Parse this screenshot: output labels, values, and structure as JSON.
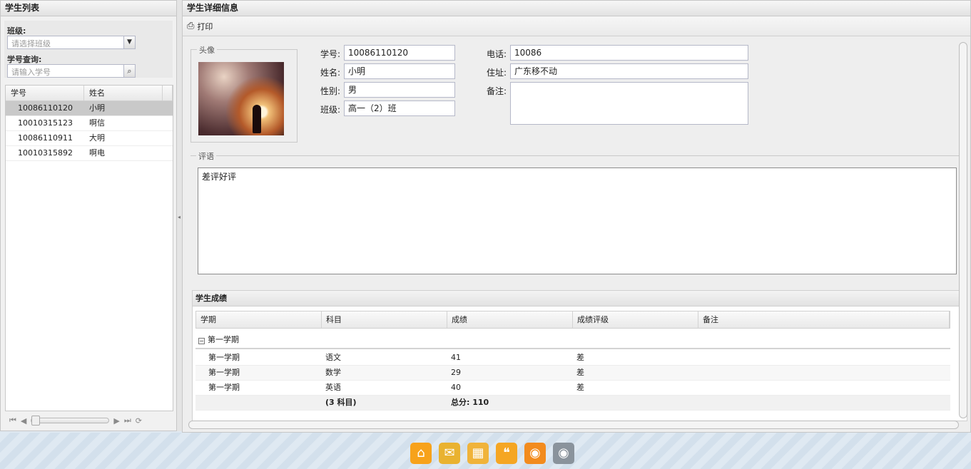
{
  "left_panel": {
    "title": "学生列表",
    "class_label": "班级:",
    "class_placeholder": "请选择班级",
    "query_label": "学号查询:",
    "query_placeholder": "请输入学号",
    "columns": [
      "学号",
      "姓名"
    ],
    "rows": [
      {
        "id": "10086110120",
        "name": "小明"
      },
      {
        "id": "10010315123",
        "name": "啊信"
      },
      {
        "id": "10086110911",
        "name": "大明"
      },
      {
        "id": "10010315892",
        "name": "啊电"
      }
    ]
  },
  "right_panel": {
    "title": "学生详细信息",
    "print_label": "打印",
    "photo_legend": "头像",
    "fields": {
      "id_label": "学号:",
      "id_value": "10086110120",
      "name_label": "姓名:",
      "name_value": "小明",
      "gender_label": "性别:",
      "gender_value": "男",
      "class_label": "班级:",
      "class_value": "高一（2）班",
      "phone_label": "电话:",
      "phone_value": "10086",
      "address_label": "住址:",
      "address_value": "广东移不动",
      "note_label": "备注:",
      "note_value": ""
    },
    "comment_legend": "评语",
    "comment_value": "差评好评",
    "scores": {
      "title": "学生成绩",
      "columns": [
        "学期",
        "科目",
        "成绩",
        "成绩评级",
        "备注"
      ],
      "group": "第一学期",
      "rows": [
        {
          "term": "第一学期",
          "subject": "语文",
          "score": "41",
          "grade": "差",
          "note": ""
        },
        {
          "term": "第一学期",
          "subject": "数学",
          "score": "29",
          "grade": "差",
          "note": ""
        },
        {
          "term": "第一学期",
          "subject": "英语",
          "score": "40",
          "grade": "差",
          "note": ""
        }
      ],
      "summary": {
        "subject": "(3 科目)",
        "score": "总分: 110"
      }
    }
  },
  "dock": {
    "icons": [
      "home-icon",
      "mail-icon",
      "calendar-icon",
      "chat-icon",
      "rss-icon",
      "rss-gray-icon"
    ]
  }
}
